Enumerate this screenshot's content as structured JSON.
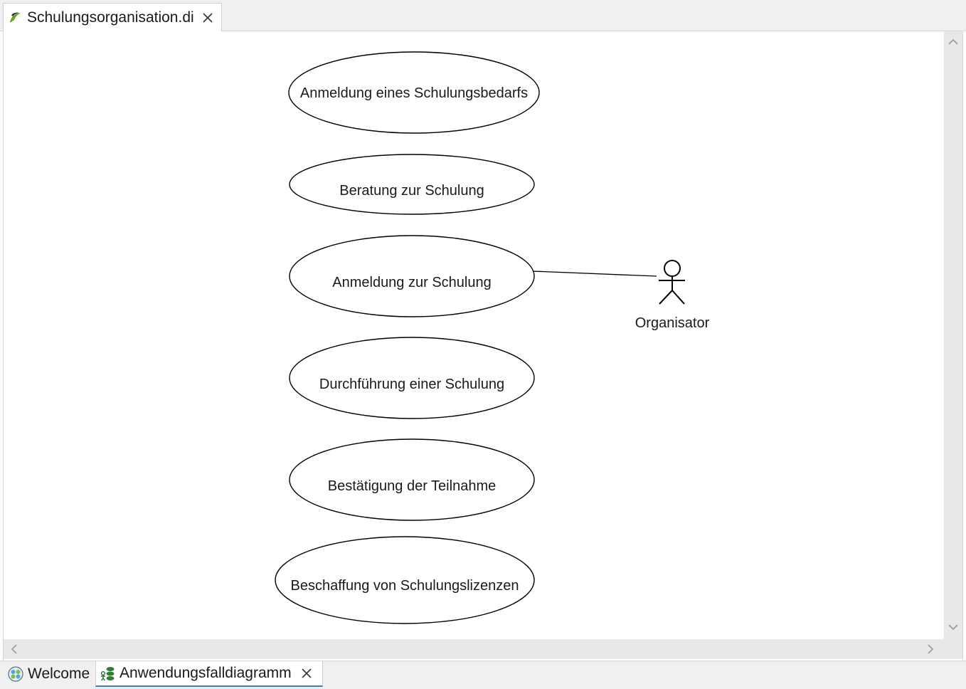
{
  "editor_tab": {
    "title": "Schulungsorganisation.di",
    "icon": "papyrus-model-icon",
    "close_icon": "close-icon"
  },
  "diagram": {
    "use_cases": [
      {
        "label": "Anmeldung eines Schulungsbedarfs"
      },
      {
        "label": "Beratung zur Schulung"
      },
      {
        "label": "Anmeldung zur Schulung"
      },
      {
        "label": "Durchführung einer Schulung"
      },
      {
        "label": "Bestätigung der Teilnahme"
      },
      {
        "label": "Beschaffung von Schulungslizenzen"
      }
    ],
    "actor": {
      "name": "Organisator",
      "associated_use_case": "Anmeldung zur Schulung"
    }
  },
  "scrollbars": {
    "up_icon": "chevron-up-icon",
    "down_icon": "chevron-down-icon",
    "left_icon": "chevron-left-icon",
    "right_icon": "chevron-right-icon"
  },
  "bottom_tabs": [
    {
      "label": "Welcome",
      "icon": "welcome-icon",
      "active": false
    },
    {
      "label": "Anwendungsfalldiagramm",
      "icon": "use-case-diagram-icon",
      "active": true,
      "close_icon": "close-icon"
    }
  ],
  "colors": {
    "tab_bar_bg": "#f0f0f0",
    "canvas_bg": "#ffffff",
    "scrollbar_bg": "#e8e8e8",
    "active_tab_underline": "#3c7fb1",
    "shape_stroke": "#000000",
    "papyrus_icon_green": "#6aa51f"
  }
}
